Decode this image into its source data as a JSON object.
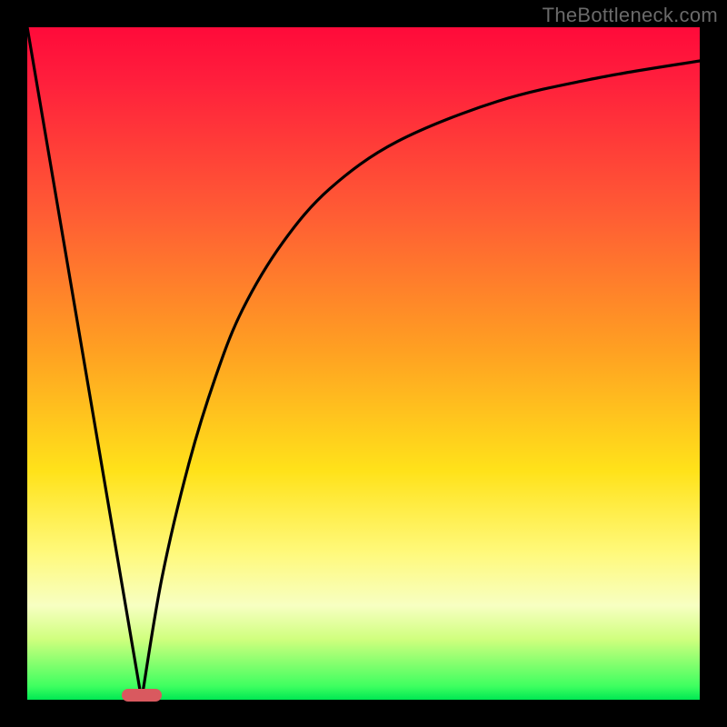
{
  "watermark": "TheBottleneck.com",
  "chart_data": {
    "type": "line",
    "title": "",
    "xlabel": "",
    "ylabel": "",
    "xlim": [
      0,
      100
    ],
    "ylim": [
      0,
      100
    ],
    "grid": false,
    "legend": false,
    "marker": {
      "x_start": 14,
      "x_end": 20,
      "y": 0,
      "color": "#d9595f"
    },
    "series": [
      {
        "name": "left-line",
        "type": "line",
        "x": [
          0,
          17
        ],
        "y": [
          100,
          0
        ]
      },
      {
        "name": "right-curve",
        "type": "line",
        "x": [
          17,
          20,
          24,
          28,
          32,
          38,
          45,
          55,
          70,
          85,
          100
        ],
        "y": [
          0,
          18,
          35,
          48,
          58,
          68,
          76,
          83,
          89,
          92.5,
          95
        ]
      }
    ],
    "background_gradient": {
      "direction": "vertical",
      "stops": [
        {
          "pos": 0.0,
          "color": "#ff0a3a"
        },
        {
          "pos": 0.28,
          "color": "#ff5d34"
        },
        {
          "pos": 0.48,
          "color": "#ffa022"
        },
        {
          "pos": 0.66,
          "color": "#ffe21a"
        },
        {
          "pos": 0.86,
          "color": "#f7ffc2"
        },
        {
          "pos": 0.98,
          "color": "#3eff60"
        },
        {
          "pos": 1.0,
          "color": "#00e853"
        }
      ]
    }
  }
}
